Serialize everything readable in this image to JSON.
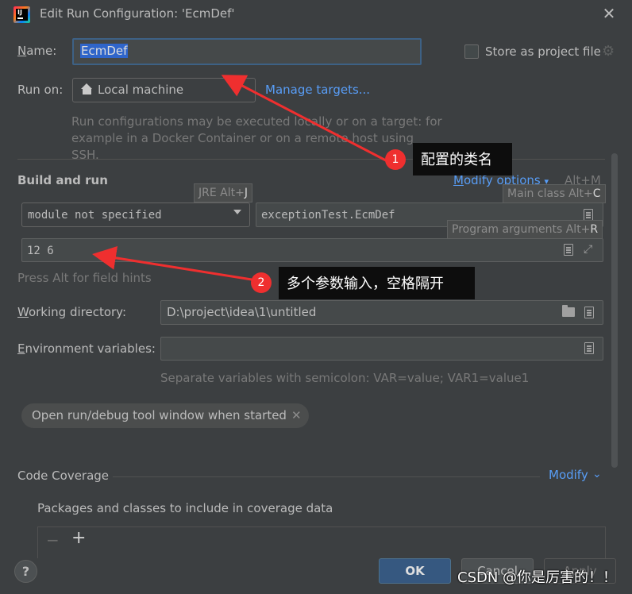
{
  "window": {
    "title": "Edit Run Configuration: 'EcmDef'"
  },
  "name_row": {
    "label_key": "N",
    "label_rest": "ame:",
    "value": "EcmDef",
    "store_label": "Store as project file"
  },
  "run_on": {
    "label": "Run on:",
    "value": "Local machine",
    "manage": "Manage targets...",
    "help": "Run configurations may be executed locally or on a target: for example in a Docker Container or on a remote host using SSH."
  },
  "build_run": {
    "title": "Build and run",
    "modify_key": "M",
    "modify_rest": "odify options",
    "modify_shortcut": "Alt+M",
    "module": "module not specified",
    "main_class": "exceptionTest.EcmDef",
    "program_args": "12 6",
    "tips": {
      "jre_prefix": "JRE Alt+",
      "jre_key": "J",
      "main_prefix": "Main class Alt+",
      "main_key": "C",
      "args_prefix": "Program arguments Alt+",
      "args_key": "R"
    },
    "alt_hint": "Press Alt for field hints"
  },
  "working_dir": {
    "label_key": "W",
    "label_rest": "orking directory:",
    "value": "D:\\project\\idea\\1\\untitled"
  },
  "env_vars": {
    "label_key": "E",
    "label_rest": "nvironment variables:",
    "value": "",
    "help": "Separate variables with semicolon: VAR=value; VAR1=value1"
  },
  "open_run_chip": "Open run/debug tool window when started",
  "coverage": {
    "title": "Code Coverage",
    "modify": "Modify",
    "packages_label": "Packages and classes to include in coverage data"
  },
  "buttons": {
    "help": "?",
    "ok": "OK",
    "cancel": "Cancel",
    "apply": "Apply"
  },
  "annotations": {
    "badge1": "1",
    "callout1": "配置的类名",
    "badge2": "2",
    "callout2": "多个参数输入，空格隔开",
    "watermark": "CSDN @你是厉害的！！"
  },
  "colors": {
    "link": "#589df6",
    "ok_button": "#365880",
    "annotation_red": "#ef2f2f",
    "selection": "#2f65ca"
  }
}
